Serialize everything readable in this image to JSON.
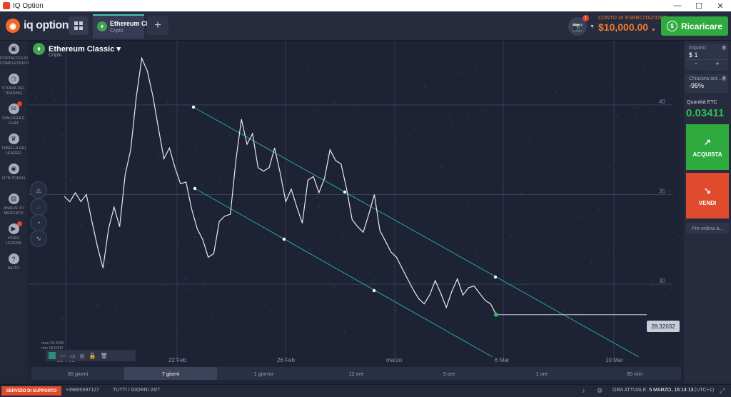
{
  "window": {
    "title": "IQ Option",
    "minimize": "—",
    "maximize": "☐",
    "close": "✕"
  },
  "header": {
    "logo": "iq option",
    "asset_tab": {
      "name": "Ethereum Cl...",
      "sub": "Cripto",
      "coin": "⬧"
    },
    "add_tab": "+",
    "balance_label": "CONTO DI ESERCITAZIONE",
    "balance_value": "$10,000.00",
    "topup_label": "Ricaricare",
    "camera_icon": "camera-icon"
  },
  "sidebar": {
    "items": [
      {
        "label": "PORTAFOGLIO COMPLESSIVO",
        "icon": "▣"
      },
      {
        "label": "STORIA DEL TRADING",
        "icon": "◷"
      },
      {
        "label": "DIALOGHI E CHAT",
        "icon": "✉"
      },
      {
        "label": "TABELLA DEI LEADER",
        "icon": "♛"
      },
      {
        "label": "OTN TOKEN",
        "icon": "◉"
      },
      {
        "label": "ANALISI DI MERCATO",
        "icon": "▤"
      },
      {
        "label": "VIDEO LEZIONI",
        "icon": "▶"
      },
      {
        "label": "AIUTO",
        "icon": "?"
      }
    ]
  },
  "asset": {
    "name": "Ethereum Classic ▾",
    "category": "Cripto",
    "coin": "⬧"
  },
  "chart_data": {
    "type": "line",
    "x_ticks": [
      "19 Feb",
      "22 Feb",
      "26 Feb",
      "marzo",
      "6 Mar",
      "10 Mar"
    ],
    "y_ticks": [
      30,
      35,
      40
    ],
    "ylim": [
      25.5,
      43.5
    ],
    "current_price": "28.32032",
    "series": [
      {
        "values": [
          34.9,
          34.6,
          35.1,
          34.6,
          35.0,
          33.5,
          32.1,
          30.9,
          33.1,
          34.3,
          33.2,
          36.1,
          37.5,
          40.4,
          42.6,
          41.9,
          40.5,
          38.7,
          37.0,
          37.6,
          36.5,
          35.6,
          35.7,
          34.2,
          33.1,
          32.5,
          31.5,
          31.7,
          33.5,
          33.8,
          33.9,
          36.9,
          39.2,
          37.8,
          38.4,
          36.5,
          36.3,
          36.5,
          37.6,
          36.2,
          34.6,
          35.3,
          34.3,
          33.4,
          35.8,
          36.0,
          35.1,
          35.9,
          37.5,
          36.9,
          36.7,
          35.3,
          33.6,
          33.2,
          32.9,
          33.9,
          35.0,
          33.0,
          32.4,
          31.8,
          31.5,
          30.9,
          30.3,
          29.7,
          29.2,
          28.9,
          29.4,
          30.2,
          29.5,
          28.7,
          29.6,
          30.3,
          29.4,
          29.8,
          29.9,
          29.5,
          29.1,
          28.9,
          28.3
        ]
      }
    ],
    "channel_points": [
      "upper start",
      "upper mid",
      "upper end",
      "lower start",
      "lower mid",
      "lower end"
    ]
  },
  "timeframes": [
    "30 giorni",
    "7 giorni",
    "1 giorno",
    "12 ore",
    "3 ore",
    "1 ore",
    "30 min"
  ],
  "timeframe_active": 1,
  "minmax": {
    "max": "max 29.3205",
    "min": "min 18.0000"
  },
  "drawtools": [
    "▦",
    "—",
    "▭",
    "◎",
    "🔓",
    "🗑"
  ],
  "right_panel": {
    "amount_label": "Importo",
    "amount_value": "$ 1",
    "minus": "−",
    "plus": "+",
    "auto_close_label": "Chiusura aut...",
    "auto_close_value": "-95%",
    "quantity_label": "Quantità ETC",
    "quantity_value": "0.03411",
    "buy_label": "ACQUISTA",
    "sell_label": "VENDI",
    "preorder_label": "Pre-ordina a..."
  },
  "footer": {
    "support": "SERVIZIO DI SUPPORTO",
    "phone": "+39800597127",
    "hours": "TUTTI I GIORNI 24/7",
    "time_label": "ORA ATTUALE:",
    "time_value": "5 MARZO, 16:14:13",
    "tz": "(UTC+1)"
  }
}
